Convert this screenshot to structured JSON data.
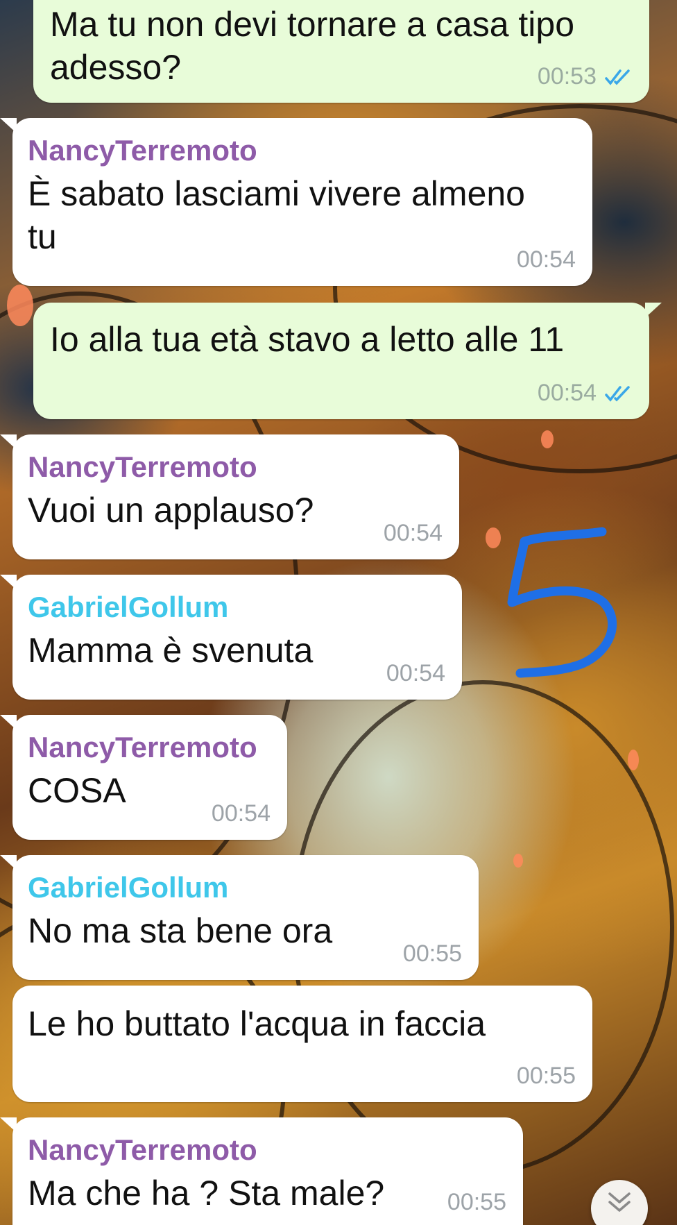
{
  "colors": {
    "incoming_bubble": "#ffffff",
    "outgoing_bubble": "#e8fcd9",
    "nancy_name": "#8e5ba8",
    "gabriel_name": "#3fc7ea",
    "read_ticks": "#3aa7e8",
    "annotation": "#1f6fe6"
  },
  "annotation": {
    "mark": "5",
    "icon": "handwritten-number-five"
  },
  "messages": [
    {
      "direction": "out",
      "text": "Ma tu non devi tornare a casa tipo adesso?",
      "time": "00:53",
      "status": "read"
    },
    {
      "direction": "in",
      "sender": "NancyTerremoto",
      "text": "È sabato lasciami vivere almeno tu",
      "time": "00:54"
    },
    {
      "direction": "out",
      "text": "Io alla tua età stavo a letto alle 11",
      "time": "00:54",
      "status": "read"
    },
    {
      "direction": "in",
      "sender": "NancyTerremoto",
      "text": "Vuoi un applauso?",
      "time": "00:54"
    },
    {
      "direction": "in",
      "sender": "GabrielGollum",
      "text": "Mamma è svenuta",
      "time": "00:54"
    },
    {
      "direction": "in",
      "sender": "NancyTerremoto",
      "text": "COSA",
      "time": "00:54"
    },
    {
      "direction": "in",
      "sender": "GabrielGollum",
      "text": "No ma sta bene ora",
      "time": "00:55"
    },
    {
      "direction": "in",
      "text": "Le ho buttato l'acqua in faccia",
      "time": "00:55"
    },
    {
      "direction": "in",
      "sender": "NancyTerremoto",
      "text": "Ma che ha ? Sta male?",
      "time": "00:55"
    }
  ],
  "scroll_button": {
    "icon": "double-chevron-down-icon"
  }
}
